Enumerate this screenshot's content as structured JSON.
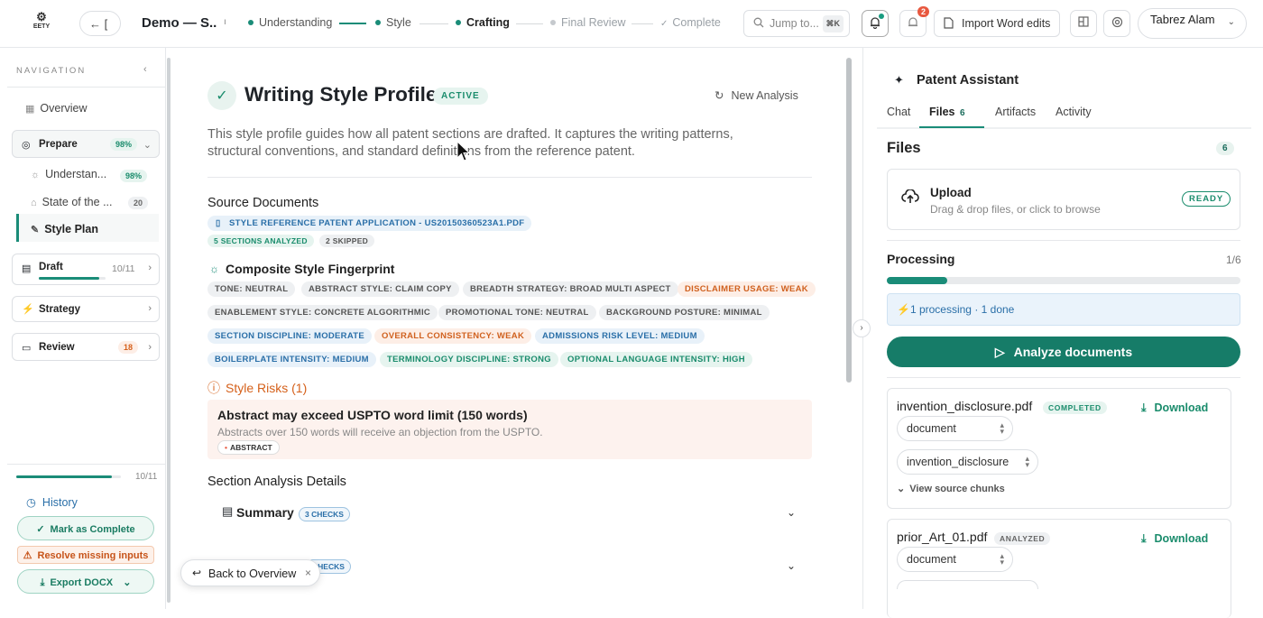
{
  "header": {
    "logo_text": "EETY",
    "back_label": "← [",
    "project_title": "Demo — S...",
    "steps": [
      {
        "label": "Understanding",
        "state": "done"
      },
      {
        "label": "Style",
        "state": "done"
      },
      {
        "label": "Crafting",
        "state": "current"
      },
      {
        "label": "Final Review",
        "state": "future"
      },
      {
        "label": "Complete",
        "state": "future"
      }
    ],
    "jump_placeholder": "Jump to...",
    "jump_kbd": "⌘K",
    "notifications_count": "2",
    "import_label": "Import Word edits",
    "user_name": "Tabrez Alam"
  },
  "sidebar": {
    "nav_label": "NAVIGATION",
    "overview": "Overview",
    "prepare": {
      "label": "Prepare",
      "pct": "98%"
    },
    "sub_items": [
      {
        "label": "Understan...",
        "badge": "98%"
      },
      {
        "label": "State of the ...",
        "badge": "20"
      },
      {
        "label": "Style Plan",
        "badge": ""
      }
    ],
    "draft": {
      "label": "Draft",
      "count": "10/11",
      "progress": 0.9
    },
    "strategy": {
      "label": "Strategy"
    },
    "review": {
      "label": "Review",
      "badge": "18"
    },
    "bottom_progress": {
      "count": "10/11",
      "progress": 0.91
    },
    "history": "History",
    "mark_complete": "Mark as Complete",
    "resolve": "Resolve missing inputs",
    "export": "Export DOCX"
  },
  "main": {
    "title": "Writing Style Profile",
    "status": "ACTIVE",
    "new_analysis": "New Analysis",
    "description": "This style profile guides how all patent sections are drafted. It captures the writing patterns, structural conventions, and standard definitions from the reference patent.",
    "source_docs_heading": "Source Documents",
    "source_doc": "STYLE REFERENCE PATENT APPLICATION - US20150360523A1.PDF",
    "sections_analyzed": "5 SECTIONS ANALYZED",
    "skipped": "2 SKIPPED",
    "fingerprint_heading": "Composite Style Fingerprint",
    "fingerprint_tags": [
      {
        "text": "TONE: NEUTRAL",
        "color": "grey"
      },
      {
        "text": "ABSTRACT STYLE: CLAIM COPY",
        "color": "grey"
      },
      {
        "text": "BREADTH STRATEGY: BROAD MULTI ASPECT",
        "color": "grey"
      },
      {
        "text": "DISCLAIMER USAGE: WEAK",
        "color": "orange"
      },
      {
        "text": "ENABLEMENT STYLE: CONCRETE ALGORITHMIC",
        "color": "grey"
      },
      {
        "text": "PROMOTIONAL TONE: NEUTRAL",
        "color": "grey"
      },
      {
        "text": "BACKGROUND POSTURE: MINIMAL",
        "color": "grey"
      },
      {
        "text": "SECTION DISCIPLINE: MODERATE",
        "color": "blue"
      },
      {
        "text": "OVERALL CONSISTENCY: WEAK",
        "color": "orange"
      },
      {
        "text": "ADMISSIONS RISK LEVEL: MEDIUM",
        "color": "blue"
      },
      {
        "text": "BOILERPLATE INTENSITY: MEDIUM",
        "color": "blue"
      },
      {
        "text": "TERMINOLOGY DISCIPLINE: STRONG",
        "color": "green"
      },
      {
        "text": "OPTIONAL LANGUAGE INTENSITY: HIGH",
        "color": "green"
      }
    ],
    "risks_heading": "Style Risks (1)",
    "risk": {
      "title": "Abstract may exceed USPTO word limit (150 words)",
      "desc": "Abstracts over 150 words will receive an objection from the USPTO.",
      "tag": "ABSTRACT"
    },
    "section_details_heading": "Section Analysis Details",
    "summary_label": "Summary",
    "summary_checks": "3 CHECKS",
    "second_checks": "CHECKS",
    "toast_label": "Back to Overview"
  },
  "right": {
    "title": "Patent Assistant",
    "tabs": [
      "Chat",
      "Files",
      "Artifacts",
      "Activity"
    ],
    "files_count": "6",
    "files_heading": "Files",
    "upload_title": "Upload",
    "upload_sub": "Drag & drop files, or click to browse",
    "upload_status": "READY",
    "processing_heading": "Processing",
    "processing_count": "1/6",
    "processing_progress": 0.17,
    "processing_note": "⚡1 processing · 1 done",
    "analyze_label": "Analyze documents",
    "download_label": "Download",
    "view_source": "View source chunks",
    "files": [
      {
        "name": "invention_disclosure.pdf",
        "status": "COMPLETED",
        "type": "document",
        "tag": "invention_disclosure"
      },
      {
        "name": "prior_Art_01.pdf",
        "status": "ANALYZED",
        "type": "document"
      }
    ]
  },
  "colors": {
    "accent": "#1a8c78",
    "warn": "#d5601a",
    "info": "#2a6fa8"
  }
}
